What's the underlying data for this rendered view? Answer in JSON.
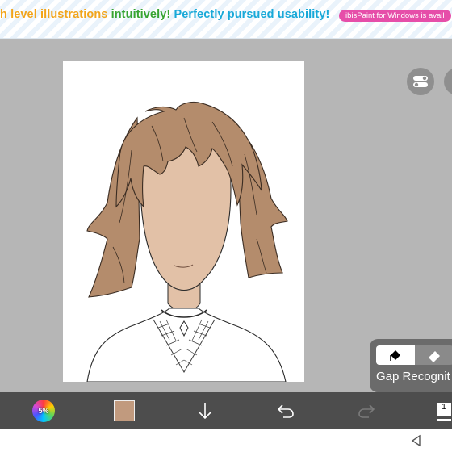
{
  "banner": {
    "segment_1": "h level illustrations",
    "segment_2": "intuitively!",
    "segment_3": "Perfectly pursued usability!",
    "pill": "ibisPaint for Windows is avail"
  },
  "fill_panel": {
    "label": "Gap Recognit",
    "tool_selected": "fill-bucket-icon",
    "tool_other": "eraser-icon"
  },
  "toolbar": {
    "brush_size": "5%",
    "current_color": "#c19a7e",
    "layer_count": "1",
    "icons": [
      "color-wheel-icon",
      "color-swatch",
      "down-arrow-icon",
      "undo-icon",
      "redo-icon",
      "layers-icon"
    ]
  },
  "right_buttons": [
    "toggle-icon",
    "more-icon"
  ],
  "colors": {
    "accent_orange": "#f2a51c",
    "accent_green": "#37a432",
    "accent_blue": "#19a9d8",
    "pill_pink": "#e64ea9",
    "hair": "#b48c6c",
    "skin": "#e2c1a7"
  }
}
